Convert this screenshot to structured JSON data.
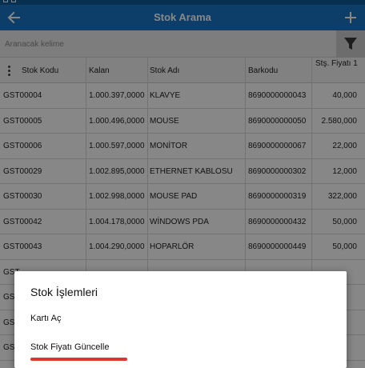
{
  "app_bar": {
    "title": "Stok Arama",
    "back_icon": "arrow-left-icon",
    "add_icon": "plus-icon",
    "color": "#1976c7"
  },
  "search": {
    "placeholder": "Aranacak kelime",
    "filter_icon": "funnel-icon"
  },
  "table": {
    "columns": [
      "Stok Kodu",
      "Kalan",
      "Stok Adı",
      "Barkodu",
      "Stş. Fiyatı 1"
    ],
    "rows": [
      {
        "code": "GST00004",
        "kalan": "1.000.397,0000",
        "ad": "KLAVYE",
        "barkod": "8690000000043",
        "fiyat": "40,000"
      },
      {
        "code": "GST00005",
        "kalan": "1.000.496,0000",
        "ad": "MOUSE",
        "barkod": "8690000000050",
        "fiyat": "2.580,000"
      },
      {
        "code": "GST00006",
        "kalan": "1.000.597,0000",
        "ad": "MONİTOR",
        "barkod": "8690000000067",
        "fiyat": "22,000"
      },
      {
        "code": "GST00029",
        "kalan": "1.002.895,0000",
        "ad": "ETHERNET KABLOSU",
        "barkod": "8690000000302",
        "fiyat": "12,000"
      },
      {
        "code": "GST00030",
        "kalan": "1.002.998,0000",
        "ad": "MOUSE PAD",
        "barkod": "8690000000319",
        "fiyat": "322,000"
      },
      {
        "code": "GST00042",
        "kalan": "1.004.178,0000",
        "ad": "WİNDOWS PDA",
        "barkod": "8690000000432",
        "fiyat": "50,000"
      },
      {
        "code": "GST00043",
        "kalan": "1.004.290,0000",
        "ad": "HOPARLÖR",
        "barkod": "8690000000449",
        "fiyat": "50,000"
      },
      {
        "code": "GST",
        "kalan": "",
        "ad": "",
        "barkod": "",
        "fiyat": ""
      },
      {
        "code": "GST",
        "kalan": "",
        "ad": "",
        "barkod": "",
        "fiyat": ""
      },
      {
        "code": "GST",
        "kalan": "",
        "ad": "",
        "barkod": "",
        "fiyat": ""
      },
      {
        "code": "GST",
        "kalan": "",
        "ad": "",
        "barkod": "",
        "fiyat": ""
      }
    ]
  },
  "dialog": {
    "title": "Stok İşlemleri",
    "items": [
      "Kartı Aç",
      "Stok Fiyatı Güncelle"
    ],
    "highlight_color": "#e0342e"
  }
}
